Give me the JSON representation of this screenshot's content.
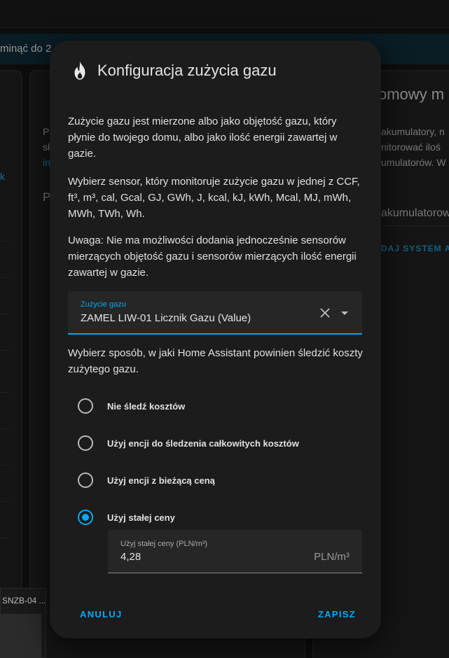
{
  "background": {
    "banner_text": "minąć do 2",
    "mid_card_lines": [
      "P",
      "sł",
      "in",
      "P"
    ],
    "left_link": "k",
    "right_card": {
      "title": "omowy m",
      "lines": [
        "akumulatory, n",
        "nitorować iloś",
        "umulatorów. W"
      ],
      "link": "W",
      "subtitle": "akumulatorow",
      "action": "DAJ SYSTEM A"
    },
    "thumbnail_caption": "SNZB-04 ..."
  },
  "dialog": {
    "title": "Konfiguracja zużycia gazu",
    "icon": "fire-icon",
    "paragraph1": "Zużycie gazu jest mierzone albo jako objętość gazu, który płynie do twojego domu, albo jako ilość energii zawartej w gazie.",
    "paragraph2": "Wybierz sensor, który monitoruje zużycie gazu w jednej z CCF, ft³, m³, cal, Gcal, GJ, GWh, J, kcal, kJ, kWh, Mcal, MJ, mWh, MWh, TWh, Wh.",
    "paragraph3": "Uwaga: Nie ma możliwości dodania jednocześnie sensorów mierzących objętość gazu i sensorów mierzących ilość energii zawartej w gazie.",
    "sensor_select": {
      "label": "Zużycie gazu",
      "value": "ZAMEL LIW-01 Licznik Gazu (Value)"
    },
    "cost_prompt": "Wybierz sposób, w jaki Home Assistant powinien śledzić koszty zużytego gazu.",
    "cost_options": [
      {
        "label": "Nie śledź kosztów",
        "checked": false
      },
      {
        "label": "Użyj encji do śledzenia całkowitych kosztów",
        "checked": false
      },
      {
        "label": "Użyj encji z bieżącą ceną",
        "checked": false
      },
      {
        "label": "Użyj stałej ceny",
        "checked": true
      }
    ],
    "fixed_price": {
      "label": "Użyj stałej ceny (PLN/m³)",
      "value": "4,28",
      "suffix": "PLN/m³"
    },
    "cancel_label": "ANULUJ",
    "save_label": "ZAPISZ",
    "accent_color": "#03a9f4"
  }
}
